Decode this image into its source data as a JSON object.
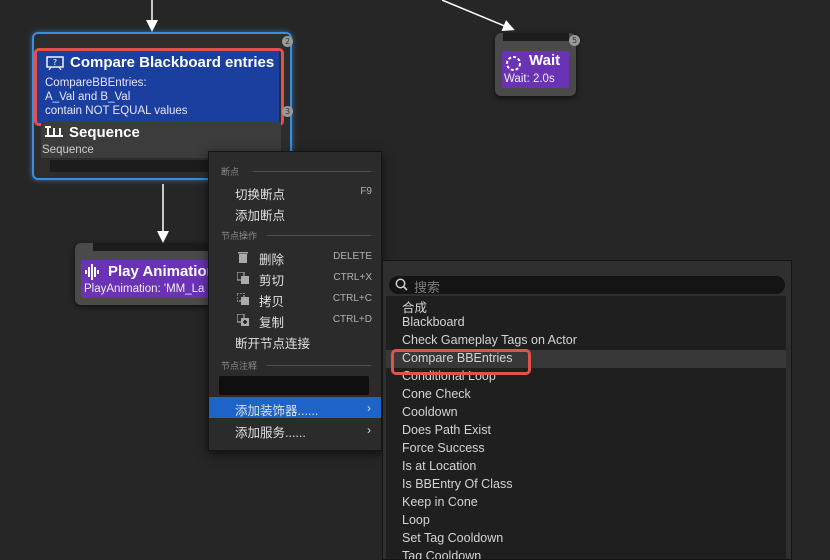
{
  "nodes": {
    "composite": {
      "decorator_title": "Compare Blackboard entries",
      "decorator_lines": [
        "CompareBBEntries:",
        "A_Val and B_Val",
        "contain NOT EQUAL values"
      ],
      "decorator_index": "2",
      "sequence_title": "Sequence",
      "sequence_subtitle": "Sequence",
      "sequence_index": "3",
      "icon": "blackboard-compare-icon"
    },
    "wait": {
      "title": "Wait",
      "subtitle": "Wait: 2.0s",
      "index": "5",
      "icon": "hourglass-circle-icon"
    },
    "play_animation": {
      "title": "Play Animation",
      "subtitle": "PlayAnimation: 'MM_La",
      "icon": "audio-wave-icon"
    }
  },
  "context_menu": {
    "section_breakpoints": "断点",
    "toggle_breakpoint": {
      "label": "切换断点",
      "shortcut": "F9"
    },
    "add_breakpoint": {
      "label": "添加断点"
    },
    "section_node_actions": "节点操作",
    "delete": {
      "label": "删除",
      "shortcut": "DELETE",
      "icon": "trash-icon"
    },
    "cut": {
      "label": "剪切",
      "shortcut": "CTRL+X",
      "icon": "cut-icon"
    },
    "copy": {
      "label": "拷贝",
      "shortcut": "CTRL+C",
      "icon": "copy-icon"
    },
    "duplicate": {
      "label": "复制",
      "shortcut": "CTRL+D",
      "icon": "duplicate-icon"
    },
    "break_links": {
      "label": "断开节点连接"
    },
    "section_comment": "节点注释",
    "comment_value": "",
    "add_decorator": {
      "label": "添加装饰器......"
    },
    "add_service": {
      "label": "添加服务......"
    }
  },
  "decorator_submenu": {
    "search_placeholder": "搜索",
    "items": [
      "合成",
      "Blackboard",
      "Check Gameplay Tags on Actor",
      "Compare BBEntries",
      "Conditional Loop",
      "Cone Check",
      "Cooldown",
      "Does Path Exist",
      "Force Success",
      "Is at Location",
      "Is BBEntry Of Class",
      "Keep in Cone",
      "Loop",
      "Set Tag Cooldown",
      "Tag Cooldown"
    ],
    "hovered_item": "Compare BBEntries"
  },
  "colors": {
    "background": "#262626",
    "selection_border": "#3a8de0",
    "decorator_blue": "#1a3f9e",
    "task_purple": "#6a33b5",
    "highlight_red": "#e0524a",
    "menu_active": "#1e63c8"
  }
}
